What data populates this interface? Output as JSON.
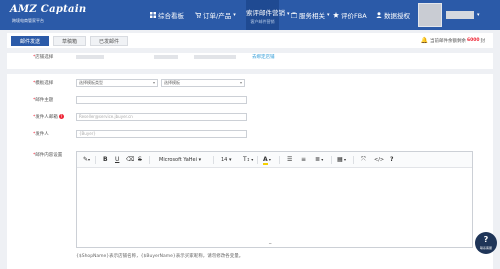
{
  "brand": {
    "name": "AMZ Captain",
    "tagline": "跨境电商管家平台"
  },
  "nav": [
    {
      "label": "综合看板",
      "icon": "dashboard-icon"
    },
    {
      "label": "订单/产品",
      "icon": "cart-icon"
    },
    {
      "label": "索评邮件营销",
      "sub": "客户邮件营销",
      "icon": "mail-icon"
    },
    {
      "label": "服务相关",
      "icon": "briefcase-icon"
    },
    {
      "label": "评价FBA",
      "icon": "star-icon"
    },
    {
      "label": "数据授权",
      "icon": "user-icon"
    }
  ],
  "tabs": [
    "邮件发送",
    "草稿箱",
    "已发邮件"
  ],
  "quota": {
    "prefix": "当前邮件余额剩余",
    "value": "6000",
    "suffix": "封"
  },
  "form": {
    "shop_label": "店铺选择",
    "shop_link": "去绑定店铺",
    "template_label": "模板选择",
    "template_type": "选择模板类型",
    "template_select": "选择模板",
    "subject_label": "邮件主题",
    "sender_email_label": "发件人邮箱",
    "sender_email_placeholder": "Reseller@service.jbuyer.cn",
    "sender_label": "发件人",
    "sender_placeholder": "{Buyer}",
    "content_label": "邮件内容设置"
  },
  "toolbar": {
    "font": "Microsoft YaHei",
    "size": "14"
  },
  "note": "{$ShopName}表示店铺名称，{$BuyerName}表示买家昵称，请勿修改各变量。",
  "fab": {
    "icon": "?",
    "label": "联系客服"
  }
}
